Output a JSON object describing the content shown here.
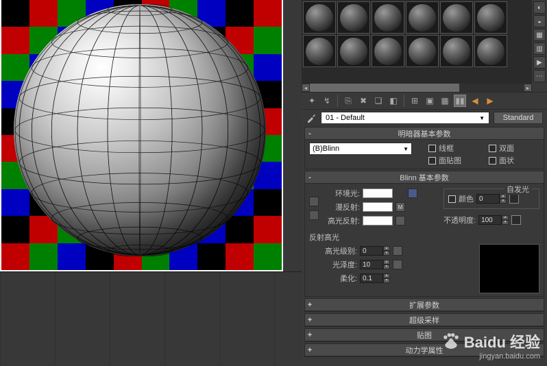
{
  "material": {
    "name": "01 - Default",
    "type": "Standard"
  },
  "shader_rollup": {
    "title": "明暗器基本参数",
    "selected": "(B)Blinn",
    "options": {
      "wireframe": "线框",
      "two_sided": "双面",
      "face_map": "面贴图",
      "faceted": "面状"
    }
  },
  "blinn_rollup": {
    "title": "Blinn 基本参数",
    "self_illum_label": "自发光",
    "ambient_label": "环境光:",
    "diffuse_label": "漫反射:",
    "specular_label": "高光反射:",
    "color_label": "颜色",
    "color_value": "0",
    "opacity_label": "不透明度:",
    "opacity_value": "100",
    "reflect_group": "反射高光",
    "spec_level_label": "高光级别:",
    "spec_level_value": "0",
    "glossiness_label": "光泽度:",
    "glossiness_value": "10",
    "soften_label": "柔化:",
    "soften_value": "0.1",
    "map_button": "M"
  },
  "extra_rollups": [
    "扩展参数",
    "超级采样",
    "贴图",
    "动力学属性"
  ],
  "watermark": {
    "brand": "Baidu 经验",
    "url": "jingyan.baidu.com"
  }
}
